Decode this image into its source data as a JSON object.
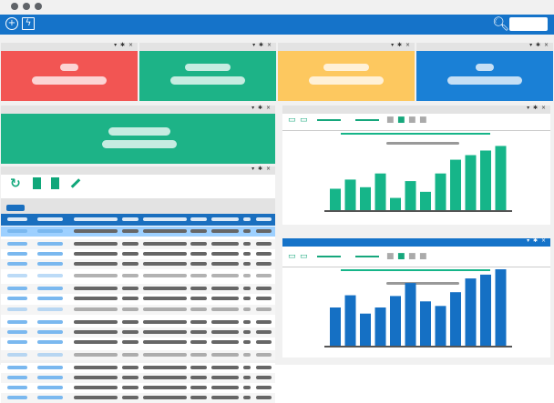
{
  "window": {
    "dots": [
      "dot",
      "dot",
      "dot"
    ]
  },
  "topbar": {
    "add_icon": "plus-circle-icon",
    "power_icon": "lightning-icon",
    "search_icon": "search-icon",
    "search_placeholder": "",
    "color": "#1573c9"
  },
  "panel_controls": "▾ ✱ ×",
  "stat_cards": [
    {
      "color": "#f25553"
    },
    {
      "color": "#1db387"
    },
    {
      "color": "#fdc85f"
    },
    {
      "color": "#1a80d6"
    }
  ],
  "grid_toolbar": {
    "refresh_icon": "↻",
    "pdf_icon": "pdf-icon",
    "excel_icon": "excel-icon",
    "edit_icon": "pencil-icon"
  },
  "chart_tools": {
    "monitor_icon": "monitor-icon",
    "trash_icon": "trash-icon",
    "excel_icon": "excel-icon"
  },
  "chart_data": [
    {
      "type": "bar",
      "title": "",
      "xlabel": "",
      "ylabel": "",
      "color": "#16b589",
      "values": [
        0.28,
        0.4,
        0.3,
        0.48,
        0.16,
        0.38,
        0.24,
        0.48,
        0.66,
        0.72,
        0.78,
        0.84
      ],
      "ylim": [
        0,
        1
      ]
    },
    {
      "type": "bar",
      "title": "",
      "xlabel": "",
      "ylabel": "",
      "color": "#1570c4",
      "values": [
        0.5,
        0.66,
        0.42,
        0.5,
        0.65,
        0.82,
        0.58,
        0.52,
        0.7,
        0.88,
        0.93,
        1.0
      ],
      "ylim": [
        0,
        1
      ]
    }
  ]
}
